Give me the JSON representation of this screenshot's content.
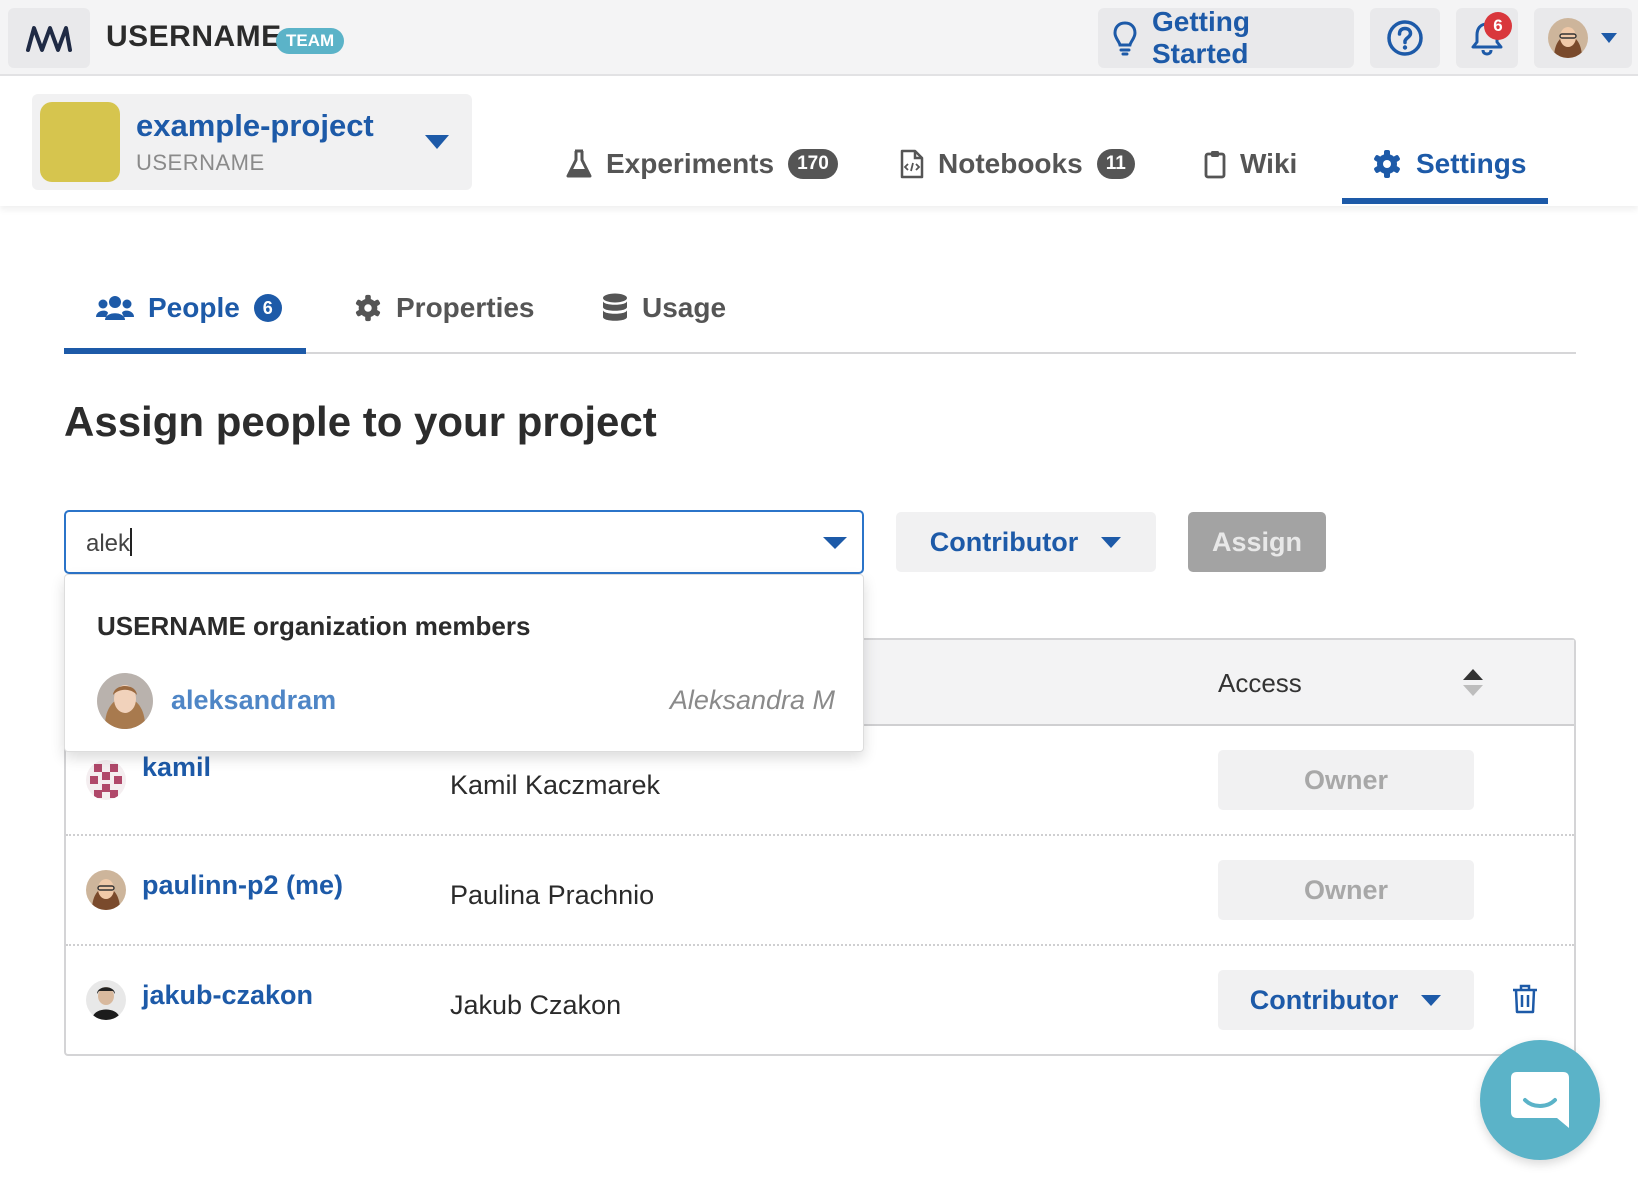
{
  "topbar": {
    "org_name": "USERNAME",
    "team_badge": "TEAM",
    "getting_started": "Getting Started",
    "notifications_count": "6",
    "logo_icon": "wave-logo-icon",
    "help_icon": "question-circle-icon",
    "bell_icon": "bell-icon",
    "bulb_icon": "lightbulb-icon"
  },
  "project": {
    "name": "example-project",
    "owner": "USERNAME",
    "avatar_color": "#d6c54e"
  },
  "project_tabs": [
    {
      "label": "Experiments",
      "count": "170",
      "icon": "flask-icon"
    },
    {
      "label": "Notebooks",
      "count": "11",
      "icon": "notebook-icon"
    },
    {
      "label": "Wiki",
      "icon": "clipboard-icon"
    },
    {
      "label": "Settings",
      "icon": "gear-icon",
      "active": true
    }
  ],
  "settings_tabs": [
    {
      "label": "People",
      "count": "6",
      "icon": "users-icon",
      "active": true
    },
    {
      "label": "Properties",
      "icon": "gear-icon"
    },
    {
      "label": "Usage",
      "icon": "database-icon"
    }
  ],
  "heading": "Assign people to your project",
  "assign": {
    "search_value": "alek",
    "role": "Contributor",
    "button": "Assign"
  },
  "dropdown": {
    "heading": "USERNAME organization members",
    "items": [
      {
        "username": "aleksandram",
        "full_name": "Aleksandra M"
      }
    ]
  },
  "table": {
    "access_header": "Access",
    "rows": [
      {
        "username": "kamil",
        "full_name": "Kamil Kaczmarek",
        "access": "Owner",
        "editable": false
      },
      {
        "username": "paulinn-p2 (me)",
        "full_name": "Paulina Prachnio",
        "access": "Owner",
        "editable": false
      },
      {
        "username": "jakub-czakon",
        "full_name": "Jakub Czakon",
        "access": "Contributor",
        "editable": true
      }
    ]
  },
  "colors": {
    "accent": "#1d5aa8",
    "teal": "#5bb3c8",
    "alert": "#d9373c"
  }
}
